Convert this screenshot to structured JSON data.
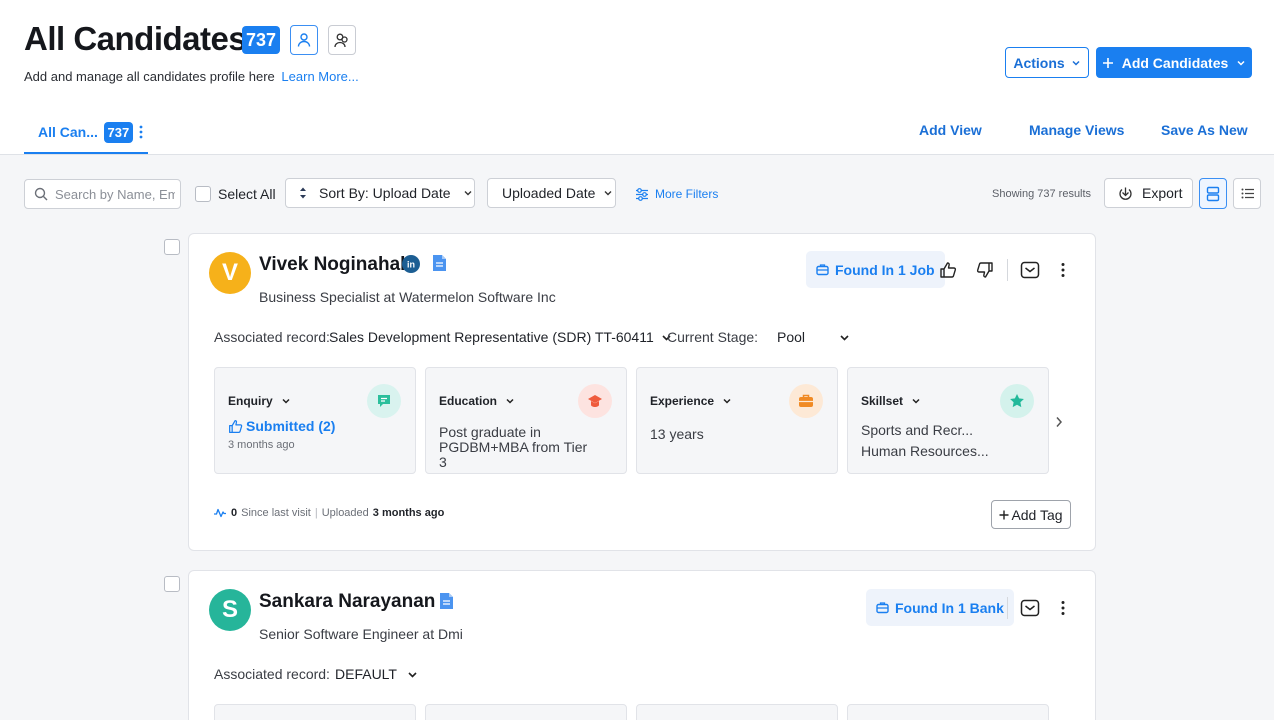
{
  "header": {
    "title": "All Candidates",
    "count": "737",
    "subtitle": "Add and manage all candidates profile here",
    "learn_more": "Learn More...",
    "actions_label": "Actions",
    "add_candidates_label": "Add Candidates"
  },
  "tabs": {
    "active_label": "All Can...",
    "active_count": "737",
    "add_view": "Add View",
    "manage_views": "Manage Views",
    "save_as_new": "Save As New"
  },
  "toolbar": {
    "search_placeholder": "Search by Name, Email",
    "select_all": "Select All",
    "sort_label": "Sort By: Upload Date",
    "date_filter": "Uploaded Date",
    "more_filters": "More Filters",
    "showing": "Showing 737 results",
    "export_label": "Export"
  },
  "candidates": [
    {
      "initial": "V",
      "avatar_color": "#f6b11a",
      "name": "Vivek Noginahal",
      "role": "Business Specialist at Watermelon Software Inc",
      "found_in": "Found In 1 Job",
      "associated_label": "Associated record:",
      "associated_value": "Sales Development Representative (SDR) TT-60411",
      "stage_label": "Current Stage:",
      "stage_value": "Pool",
      "info": {
        "enquiry_title": "Enquiry",
        "enquiry_status": "Submitted (2)",
        "enquiry_time": "3 months ago",
        "education_title": "Education",
        "education_value": "Post graduate in PGDBM+MBA from Tier 3",
        "experience_title": "Experience",
        "experience_value": "13 years",
        "skillset_title": "Skillset",
        "skill_1": "Sports and Recr...",
        "skill_2": "Human Resources..."
      },
      "since_count": "0",
      "since_label": "Since last visit",
      "uploaded_label": "Uploaded",
      "uploaded_value": "3 months ago",
      "add_tag": "Add Tag"
    },
    {
      "initial": "S",
      "avatar_color": "#26b59a",
      "name": "Sankara Narayanan",
      "role": "Senior Software Engineer at Dmi",
      "found_in": "Found In 1 Bank",
      "associated_label": "Associated record:",
      "associated_value": "DEFAULT"
    }
  ],
  "colors": {
    "accent": "#1a7ff0",
    "enquiry_icon_bg": "#d9f3ef",
    "education_icon_bg": "#fde3e0",
    "experience_icon_bg": "#fde9d6",
    "skillset_icon_bg": "#d4f2ec"
  }
}
